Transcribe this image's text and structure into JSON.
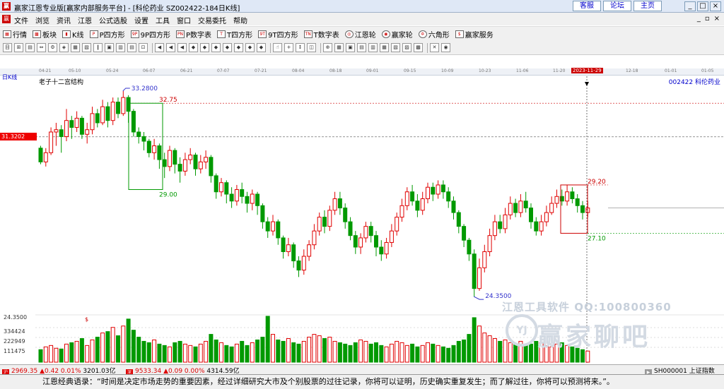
{
  "window": {
    "title": "赢家江恩专业版[赢家内部服务平台] - [科伦药业   SZ002422-184日K线]",
    "links": [
      "客服",
      "论坛",
      "主页"
    ],
    "controls": [
      "_",
      "□",
      "×"
    ]
  },
  "menu": {
    "items": [
      "文件",
      "浏览",
      "资讯",
      "江恩",
      "公式选股",
      "设置",
      "工具",
      "窗口",
      "交易委托",
      "帮助"
    ],
    "mdi_controls": [
      "_",
      "▫",
      "×"
    ]
  },
  "toolbar": {
    "items": [
      "行情",
      "板块",
      "K线",
      "P四方形",
      "9P四方形",
      "P数字表",
      "T四方形",
      "9T四方形",
      "T数字表",
      "江恩轮",
      "赢家轮",
      "六角形",
      "赢家服务"
    ]
  },
  "date_axis": {
    "labels": [
      "04-21",
      "05-10",
      "05-24",
      "06-07",
      "06-21",
      "07-07",
      "07-21",
      "08-04",
      "08-18",
      "09-01",
      "09-15",
      "10-09",
      "10-23",
      "11-06",
      "11-20",
      "2023-11-29",
      "12-18",
      "01-01",
      "01-05"
    ],
    "selected": "2023-11-29"
  },
  "chart_header": {
    "period_label": "日K线",
    "structure_label": "老子十二宫结构",
    "stock_label": "002422 科伦药业",
    "cursor_price": "31.3202"
  },
  "annotations": {
    "high_price": "33.2800",
    "box1_top": "32.75",
    "box1_bottom": "29.00",
    "box2_top": "29.20",
    "box2_bottom": "27.10",
    "low_price": "24.3500"
  },
  "volume_axis": {
    "labels": [
      "24.3500",
      "334424",
      "222949",
      "111475"
    ]
  },
  "watermark": {
    "line1": "江恩工具软件  QQ:100800360",
    "line2": "赢家聊吧",
    "logo": "YJ"
  },
  "status": {
    "sh_index": "2969.35",
    "sh_change": "▲0.42 0.01%",
    "sh_amount": "3201.03亿",
    "sz_index": "9533.34",
    "sz_change": "▲0.09 0.00%",
    "sz_amount": "4314.59亿",
    "ticker": "SH000001 上证指数"
  },
  "quote": {
    "text": "江恩经典语录：“时间是决定市场走势的重要因素，经过详细研究大市及个别股票的过往记录，你将可以证明，历史确实重复发生；而了解过往，你将可以预测将来。”。"
  },
  "colors": {
    "up": "#e00000",
    "down": "#009900",
    "accent": "#0000cc"
  },
  "chart_data": {
    "type": "candlestick",
    "price_range": [
      23.8,
      33.8
    ],
    "candles": [
      [
        30.8,
        30.2,
        30.9,
        30.1
      ],
      [
        30.2,
        30.6,
        30.8,
        30.0
      ],
      [
        30.6,
        31.5,
        31.7,
        30.5
      ],
      [
        31.5,
        31.6,
        31.9,
        30.9
      ],
      [
        31.6,
        31.3,
        31.8,
        30.6
      ],
      [
        31.3,
        32.0,
        32.5,
        31.1
      ],
      [
        32.0,
        31.7,
        32.2,
        31.2
      ],
      [
        31.7,
        32.1,
        32.4,
        31.5
      ],
      [
        32.1,
        31.4,
        32.2,
        31.2
      ],
      [
        31.4,
        31.6,
        31.9,
        31.0
      ],
      [
        31.6,
        32.3,
        32.6,
        31.4
      ],
      [
        32.3,
        31.9,
        32.5,
        31.7
      ],
      [
        31.9,
        32.6,
        32.9,
        31.8
      ],
      [
        32.6,
        32.0,
        32.8,
        31.7
      ],
      [
        32.0,
        32.8,
        33.0,
        31.8
      ],
      [
        32.8,
        32.3,
        33.0,
        32.1
      ],
      [
        32.3,
        33.0,
        33.28,
        32.2
      ],
      [
        33.0,
        32.4,
        33.1,
        31.9
      ],
      [
        32.4,
        31.5,
        32.5,
        31.3
      ],
      [
        31.5,
        31.3,
        31.7,
        31.0
      ],
      [
        31.3,
        31.1,
        31.5,
        30.7
      ],
      [
        31.1,
        30.6,
        31.2,
        30.4
      ],
      [
        30.6,
        30.9,
        31.2,
        30.3
      ],
      [
        30.9,
        30.3,
        31.0,
        29.9
      ],
      [
        30.3,
        30.0,
        30.6,
        29.5
      ],
      [
        30.0,
        30.7,
        30.9,
        29.8
      ],
      [
        30.7,
        30.1,
        30.8,
        29.7
      ],
      [
        30.1,
        29.8,
        30.4,
        29.3
      ],
      [
        29.8,
        30.3,
        30.6,
        29.6
      ],
      [
        30.3,
        30.5,
        30.8,
        30.1
      ],
      [
        30.5,
        29.9,
        30.6,
        29.6
      ],
      [
        29.9,
        30.2,
        30.5,
        29.7
      ],
      [
        30.2,
        30.4,
        30.7,
        29.9
      ],
      [
        30.4,
        29.6,
        30.5,
        29.3
      ],
      [
        29.6,
        28.9,
        29.7,
        28.6
      ],
      [
        28.9,
        29.3,
        29.5,
        28.7
      ],
      [
        29.3,
        28.8,
        29.4,
        28.4
      ],
      [
        28.8,
        28.5,
        29.1,
        28.2
      ],
      [
        28.5,
        29.0,
        29.2,
        28.3
      ],
      [
        29.0,
        28.7,
        29.3,
        28.4
      ],
      [
        28.7,
        28.4,
        28.9,
        28.0
      ],
      [
        28.4,
        28.8,
        29.0,
        28.1
      ],
      [
        28.8,
        28.3,
        28.9,
        27.9
      ],
      [
        28.3,
        27.6,
        28.4,
        27.3
      ],
      [
        27.6,
        27.2,
        27.8,
        26.9
      ],
      [
        27.2,
        27.6,
        27.9,
        27.0
      ],
      [
        27.6,
        26.9,
        27.7,
        26.6
      ],
      [
        26.9,
        26.3,
        27.0,
        26.0
      ],
      [
        26.3,
        26.6,
        26.9,
        26.1
      ],
      [
        26.6,
        25.9,
        26.7,
        25.6
      ],
      [
        25.9,
        25.5,
        26.1,
        25.2
      ],
      [
        25.5,
        26.1,
        26.4,
        25.3
      ],
      [
        26.1,
        26.6,
        26.8,
        25.9
      ],
      [
        26.6,
        27.2,
        27.5,
        26.4
      ],
      [
        27.2,
        27.8,
        28.0,
        27.0
      ],
      [
        27.8,
        27.4,
        28.1,
        27.1
      ],
      [
        27.4,
        28.1,
        28.3,
        27.2
      ],
      [
        28.1,
        28.6,
        28.9,
        27.9
      ],
      [
        28.6,
        28.2,
        28.9,
        27.9
      ],
      [
        28.2,
        27.6,
        28.4,
        27.3
      ],
      [
        27.6,
        27.0,
        27.8,
        26.8
      ],
      [
        27.0,
        26.5,
        27.2,
        26.2
      ],
      [
        26.5,
        26.9,
        27.1,
        26.2
      ],
      [
        26.9,
        27.4,
        27.6,
        26.7
      ],
      [
        27.4,
        27.0,
        27.6,
        26.7
      ],
      [
        27.0,
        26.5,
        27.2,
        26.1
      ],
      [
        26.5,
        26.2,
        26.8,
        25.9
      ],
      [
        26.2,
        26.7,
        26.9,
        26.0
      ],
      [
        26.7,
        27.2,
        27.5,
        26.5
      ],
      [
        27.2,
        27.8,
        28.0,
        27.0
      ],
      [
        27.8,
        28.3,
        28.6,
        27.6
      ],
      [
        28.3,
        28.9,
        29.1,
        28.1
      ],
      [
        28.9,
        28.5,
        29.2,
        28.3
      ],
      [
        28.5,
        28.1,
        28.8,
        27.8
      ],
      [
        28.1,
        28.6,
        28.9,
        27.9
      ],
      [
        28.6,
        29.1,
        29.3,
        28.4
      ],
      [
        29.1,
        28.8,
        29.3,
        28.5
      ],
      [
        28.8,
        29.2,
        29.4,
        28.6
      ],
      [
        29.2,
        28.9,
        29.4,
        28.6
      ],
      [
        28.9,
        28.5,
        29.1,
        28.2
      ],
      [
        28.5,
        28.0,
        28.7,
        27.7
      ],
      [
        28.0,
        27.4,
        28.1,
        27.1
      ],
      [
        27.4,
        26.8,
        27.5,
        26.5
      ],
      [
        26.8,
        26.2,
        26.9,
        25.9
      ],
      [
        26.2,
        24.7,
        26.4,
        24.35
      ],
      [
        24.7,
        25.6,
        26.0,
        24.6
      ],
      [
        25.6,
        26.3,
        26.6,
        25.4
      ],
      [
        26.3,
        27.0,
        27.3,
        26.1
      ],
      [
        27.0,
        27.6,
        27.9,
        26.8
      ],
      [
        27.6,
        27.3,
        27.9,
        27.1
      ],
      [
        27.3,
        27.9,
        28.2,
        27.1
      ],
      [
        27.9,
        28.4,
        28.7,
        27.7
      ],
      [
        28.4,
        28.0,
        28.6,
        27.8
      ],
      [
        28.0,
        28.5,
        28.8,
        27.8
      ],
      [
        28.5,
        28.2,
        28.9,
        28.0
      ],
      [
        28.2,
        27.6,
        28.4,
        27.3
      ],
      [
        27.6,
        27.2,
        27.8,
        27.0
      ],
      [
        27.2,
        27.6,
        27.9,
        27.0
      ],
      [
        27.6,
        28.0,
        28.3,
        27.4
      ],
      [
        28.0,
        28.4,
        28.7,
        27.9
      ],
      [
        28.4,
        28.7,
        29.0,
        28.2
      ],
      [
        28.7,
        28.5,
        29.0,
        28.3
      ],
      [
        28.5,
        28.9,
        29.2,
        28.3
      ],
      [
        28.9,
        28.6,
        29.1,
        28.4
      ],
      [
        28.6,
        28.3,
        28.8,
        28.0
      ],
      [
        28.3,
        28.0,
        28.5,
        27.7
      ],
      [
        28.0,
        28.2,
        28.5,
        27.8
      ]
    ],
    "volumes": [
      90000,
      110000,
      120000,
      100000,
      95000,
      130000,
      140000,
      150000,
      170000,
      120000,
      160000,
      180000,
      210000,
      220000,
      250000,
      190000,
      260000,
      310000,
      230000,
      180000,
      150000,
      140000,
      160000,
      130000,
      120000,
      110000,
      140000,
      150000,
      130000,
      120000,
      110000,
      130000,
      150000,
      200000,
      160000,
      140000,
      120000,
      110000,
      130000,
      150000,
      120000,
      140000,
      160000,
      180000,
      330000,
      200000,
      160000,
      150000,
      170000,
      140000,
      130000,
      150000,
      180000,
      200000,
      190000,
      170000,
      180000,
      150000,
      140000,
      130000,
      120000,
      140000,
      160000,
      150000,
      130000,
      140000,
      120000,
      110000,
      130000,
      150000,
      140000,
      120000,
      130000,
      110000,
      120000,
      140000,
      130000,
      120000,
      110000,
      100000,
      120000,
      150000,
      160000,
      200000,
      320000,
      260000,
      210000,
      190000,
      170000,
      150000,
      160000,
      140000,
      130000,
      150000,
      120000,
      130000,
      150000,
      140000,
      120000,
      110000,
      130000,
      140000,
      120000,
      110000,
      100000,
      90000,
      80000
    ]
  }
}
